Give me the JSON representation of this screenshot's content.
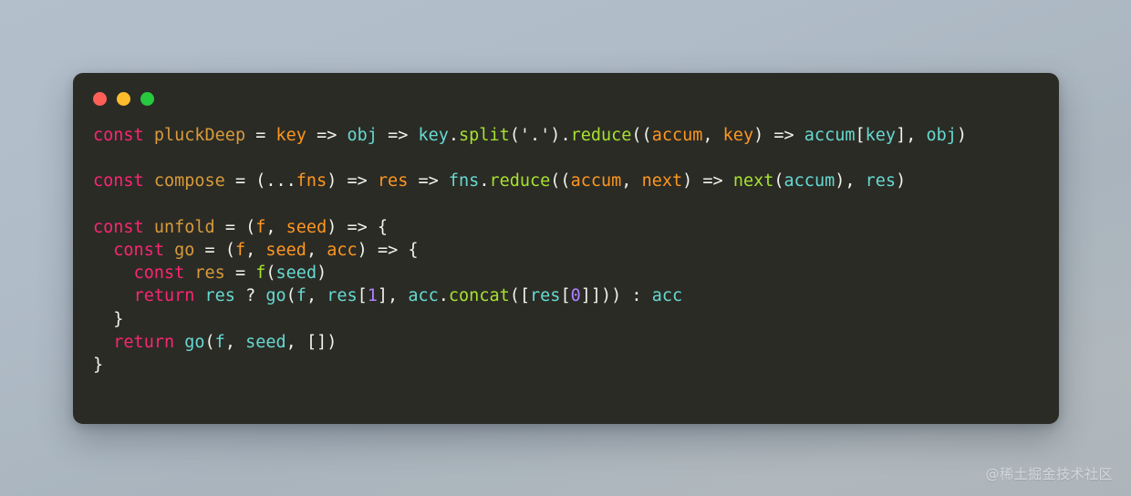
{
  "window": {
    "traffic_lights": [
      {
        "name": "close-button",
        "color": "#ff5f56"
      },
      {
        "name": "minimize-button",
        "color": "#ffbd2e"
      },
      {
        "name": "maximize-button",
        "color": "#27c93f"
      }
    ],
    "background_color": "#2b2b26"
  },
  "page": {
    "background_from": "#b3bfcb",
    "background_to": "#adb5ba"
  },
  "code": {
    "language": "javascript",
    "lines": [
      "const pluckDeep = key => obj => key.split('.').reduce((accum, key) => accum[key], obj)",
      "",
      "const compose = (...fns) => res => fns.reduce((accum, next) => next(accum), res)",
      "",
      "const unfold = (f, seed) => {",
      "  const go = (f, seed, acc) => {",
      "    const res = f(seed)",
      "    return res ? go(f, res[1], acc.concat([res[0]])) : acc",
      "  }",
      "  return go(f, seed, [])",
      "}"
    ]
  },
  "watermark": {
    "text": "@稀土掘金技术社区"
  }
}
